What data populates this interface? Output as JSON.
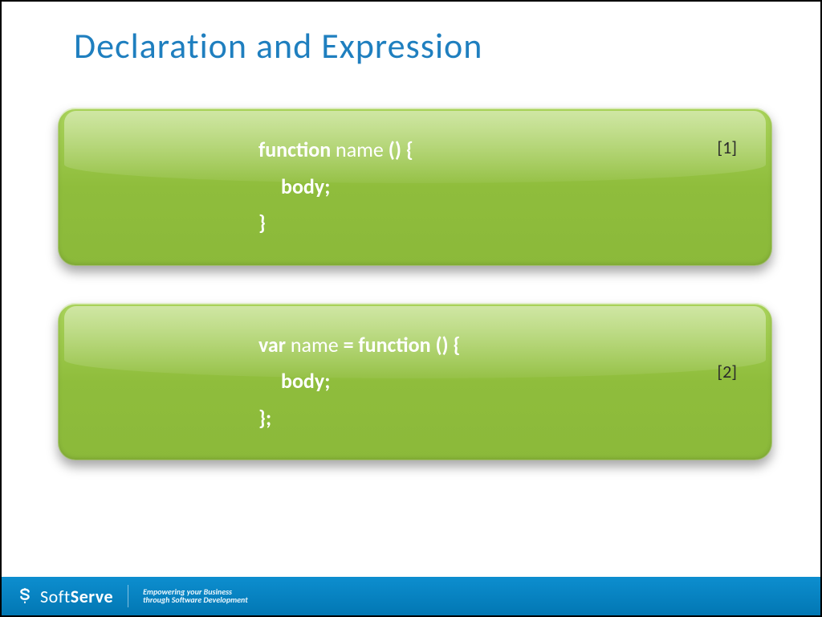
{
  "title": "Declaration and Expression",
  "boxes": [
    {
      "badge": "[1]",
      "lines": [
        {
          "segments": [
            {
              "text": "function",
              "kw": true
            },
            {
              "text": " name "
            },
            {
              "text": "() {",
              "kw": true
            }
          ]
        },
        {
          "indent": true,
          "segments": [
            {
              "text": "body;",
              "kw": true
            }
          ]
        },
        {
          "segments": [
            {
              "text": "}",
              "kw": true
            }
          ]
        }
      ]
    },
    {
      "badge": "[2]",
      "lines": [
        {
          "segments": [
            {
              "text": "var",
              "kw": true
            },
            {
              "text": " name "
            },
            {
              "text": "= function () {",
              "kw": true
            }
          ]
        },
        {
          "indent": true,
          "segments": [
            {
              "text": "body;",
              "kw": true
            }
          ]
        },
        {
          "segments": [
            {
              "text": "};",
              "kw": true
            }
          ]
        }
      ]
    }
  ],
  "footer": {
    "brand_soft": "Soft",
    "brand_serve": "Serve",
    "tagline1": "Empowering your Business",
    "tagline2": "through Software Development"
  }
}
